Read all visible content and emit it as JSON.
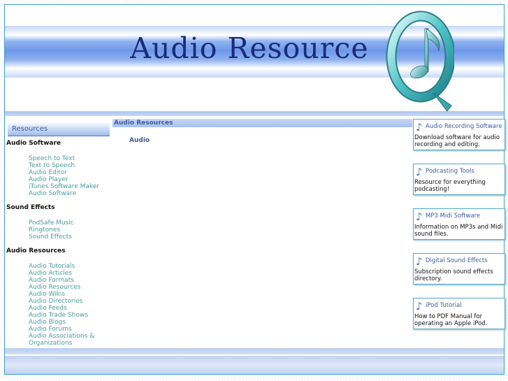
{
  "site": {
    "title": "Audio Resource"
  },
  "sidebar": {
    "header": "Resources",
    "sections": [
      {
        "title": "Audio Software",
        "links": [
          "Speech to Text",
          "Text to Speech",
          "Audio Editor",
          "Audio Player",
          "iTunes Software Maker",
          "Audio Software"
        ]
      },
      {
        "title": "Sound Effects",
        "links": [
          "PodSafe Music",
          "Ringtones",
          "Sound Effects"
        ]
      },
      {
        "title": "Audio Resources",
        "links": [
          "Audio Tutorials",
          "Audio Articles",
          "Audio Formats",
          "Audio Resources",
          "Audio Wikis",
          "Audio Directories",
          "Audio Feeds",
          "Audio Trade Shows",
          "Audio Blogs",
          "Audio Forums",
          "Audio Associations & Organizations"
        ]
      }
    ]
  },
  "main": {
    "header": "Audio Resources",
    "subheading": "Audio"
  },
  "cards": [
    {
      "title": "Audio Recording Software",
      "description": "Download software for audio recording and editing.",
      "icon": "music-note-icon"
    },
    {
      "title": "Podcasting Tools",
      "description": "Resource for everything podcasting!",
      "icon": "music-note-icon"
    },
    {
      "title": "MP3 Midi Software",
      "description": "Information on MP3s and Midi sound files.",
      "icon": "music-note-icon"
    },
    {
      "title": "Digital Sound Effects",
      "description": "Subscription sound effects directory.",
      "icon": "music-note-icon"
    },
    {
      "title": "iPod Tutorial",
      "description": "How to PDF Manual for operating an Apple iPod.",
      "icon": "music-note-icon"
    }
  ],
  "colors": {
    "accent": "#3ea0c8",
    "link": "#4c9a9e",
    "heading": "#3f5c9a",
    "banner": "#6d97ea"
  }
}
